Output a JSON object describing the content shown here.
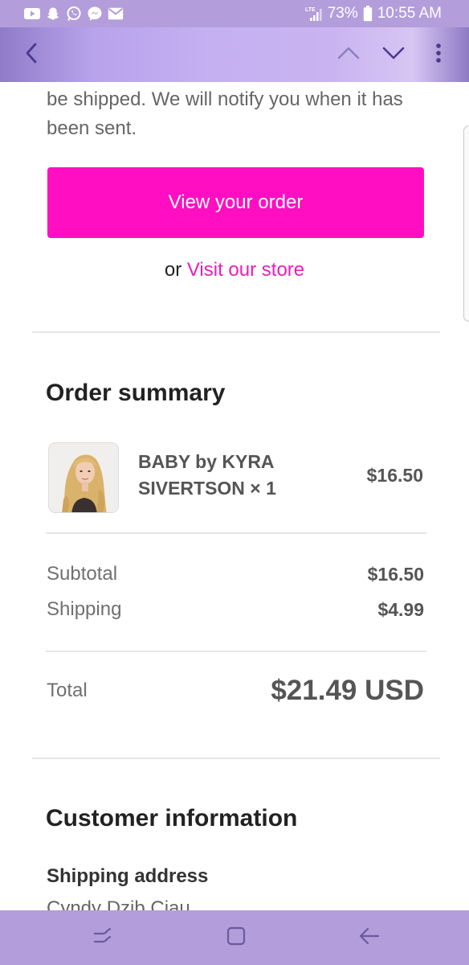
{
  "status_bar": {
    "notification_icons": [
      "youtube-icon",
      "snapchat-icon",
      "whatsapp-icon",
      "messenger-icon",
      "gmail-icon"
    ],
    "network": "LTE",
    "battery_percent": "73%",
    "time": "10:55 AM"
  },
  "toolbar": {
    "icons": [
      "back-icon",
      "chevron-up-icon",
      "chevron-down-icon",
      "more-vert-icon"
    ]
  },
  "email": {
    "intro_text": "be shipped. We will notify you when it has been sent.",
    "view_order_button": "View your order",
    "visit_prefix": "or",
    "visit_link": "Visit our store",
    "order_summary": {
      "heading": "Order summary",
      "items": [
        {
          "name": "BABY by KYRA SIVERTSON × 1",
          "price": "$16.50",
          "thumbnail": "woman-portrait-image"
        }
      ],
      "subtotal_label": "Subtotal",
      "subtotal_value": "$16.50",
      "shipping_label": "Shipping",
      "shipping_value": "$4.99",
      "total_label": "Total",
      "total_value": "$21.49 USD"
    },
    "customer_information": {
      "heading": "Customer information",
      "shipping_address_label": "Shipping address",
      "shipping_address_name": "Cyndy Dzib Ciau"
    }
  },
  "nav_bar": {
    "icons": [
      "recent-apps-icon",
      "home-icon",
      "back-icon"
    ]
  },
  "colors": {
    "system_bar": "#b39ddb",
    "accent_button": "#ff0fc1",
    "link": "#e91ebd"
  }
}
